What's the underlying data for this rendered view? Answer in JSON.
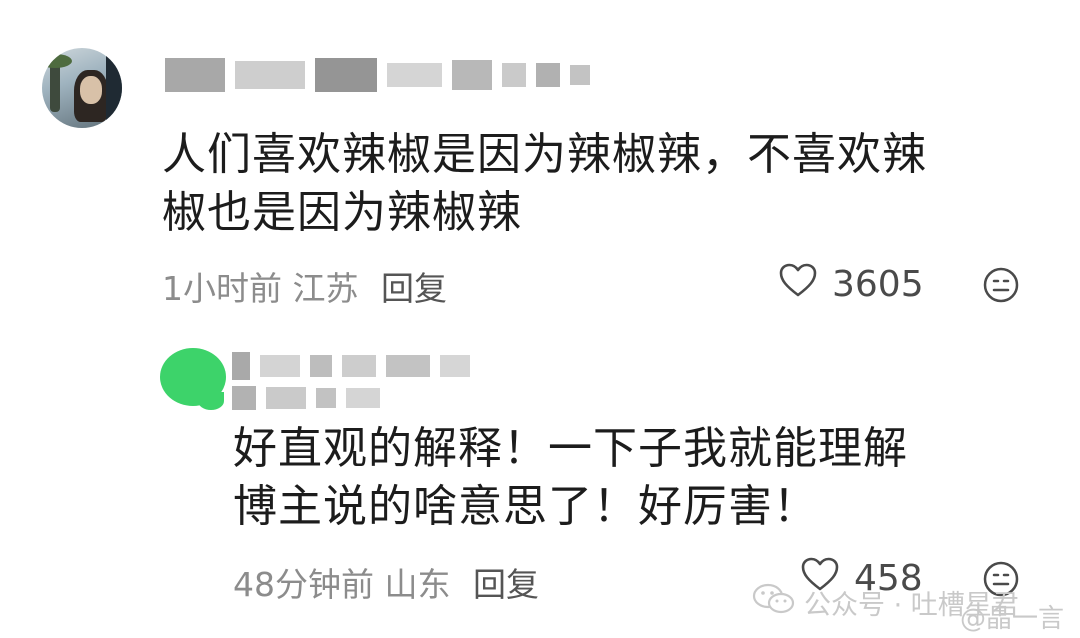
{
  "comments": [
    {
      "text_line1": "人们喜欢辣椒是因为辣椒辣，不喜欢辣",
      "text_line2": "椒也是因为辣椒辣",
      "time": "1小时前",
      "location": "江苏",
      "reply_label": "回复",
      "likes": "3605"
    },
    {
      "text_line1": "好直观的解释！一下子我就能理解",
      "text_line2": "博主说的啥意思了！好厉害！",
      "time": "48分钟前",
      "location": "山东",
      "reply_label": "回复",
      "likes": "458"
    }
  ],
  "watermark": {
    "account": "公众号 · 吐槽星君",
    "weibo": "@晶一言"
  },
  "icons": {
    "like": "heart-outline-icon",
    "reaction": "neutral-face-icon",
    "watermark": "wechat-icon"
  }
}
